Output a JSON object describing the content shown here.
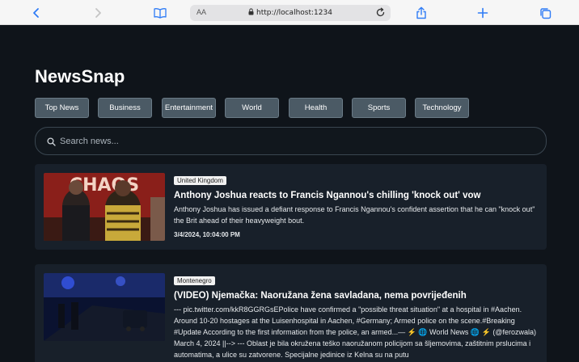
{
  "browser": {
    "address": "http://localhost:1234",
    "reader_label": "AA"
  },
  "app": {
    "title": "NewsSnap",
    "categories": [
      "Top News",
      "Business",
      "Entertainment",
      "World",
      "Health",
      "Sports",
      "Technology"
    ],
    "search": {
      "placeholder": "Search news..."
    }
  },
  "articles": [
    {
      "country": "United Kingdom",
      "title": "Anthony Joshua reacts to Francis Ngannou's chilling 'knock out' vow",
      "description": "Anthony Joshua has issued a defiant response to Francis Ngannou's confident assertion that he can \"knock out\" the Brit ahead of their heavyweight bout.",
      "date": "3/4/2024, 10:04:00 PM",
      "thumb_text": "CHAOS"
    },
    {
      "country": "Montenegro",
      "title": "(VIDEO) Njemačka: Naoružana žena savladana, nema povrijeđenih",
      "description": "--- pic.twitter.com/kkR8GGRGsEPolice have confirmed a \"possible threat situation\" at a hospital in #Aachen. Around 10-20 hostages at the Luisenhospital in Aachen, #Germany; Armed police on the scene.#Breaking #Update According to the first information from the police, an armed...— ⚡ 🌐 World News 🌐 ⚡ (@ferozwala) March 4, 2024 ||--> --- Oblast je bila okružena teško naoružanom policijom sa šljemovima, zaštitnim prslucima i automatima, a ulice su zatvorene. Specijalne jedinice iz Kelna su na putu",
      "date": ""
    }
  ]
}
